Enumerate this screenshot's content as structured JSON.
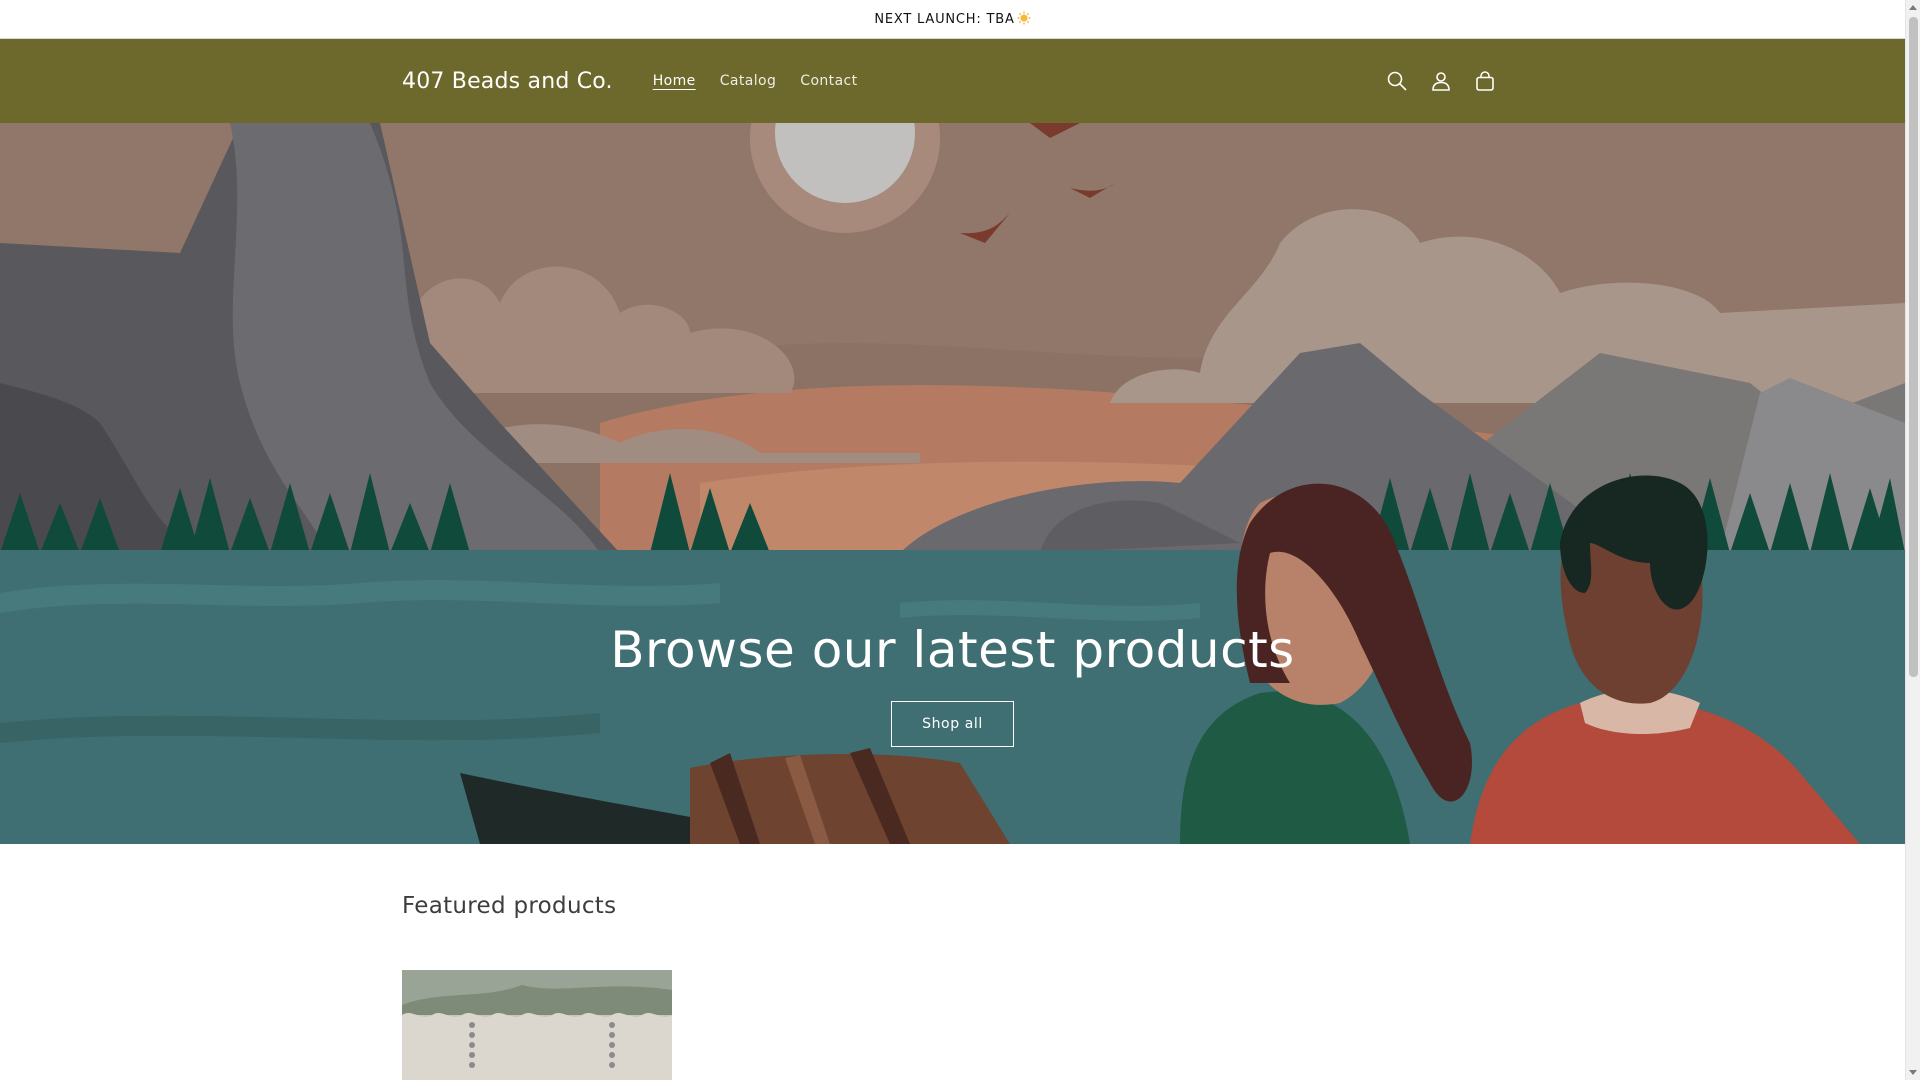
{
  "announcement": {
    "text": "NEXT LAUNCH: TBA",
    "emoji_icon": "sun-icon"
  },
  "header": {
    "logo": "407 Beads and Co.",
    "nav": [
      {
        "label": "Home",
        "active": true
      },
      {
        "label": "Catalog",
        "active": false
      },
      {
        "label": "Contact",
        "active": false
      }
    ],
    "icons": [
      "search-icon",
      "account-icon",
      "cart-icon"
    ],
    "background_color": "#6d682b"
  },
  "hero": {
    "title": "Browse our latest products",
    "button_label": "Shop all"
  },
  "featured": {
    "title": "Featured products"
  }
}
